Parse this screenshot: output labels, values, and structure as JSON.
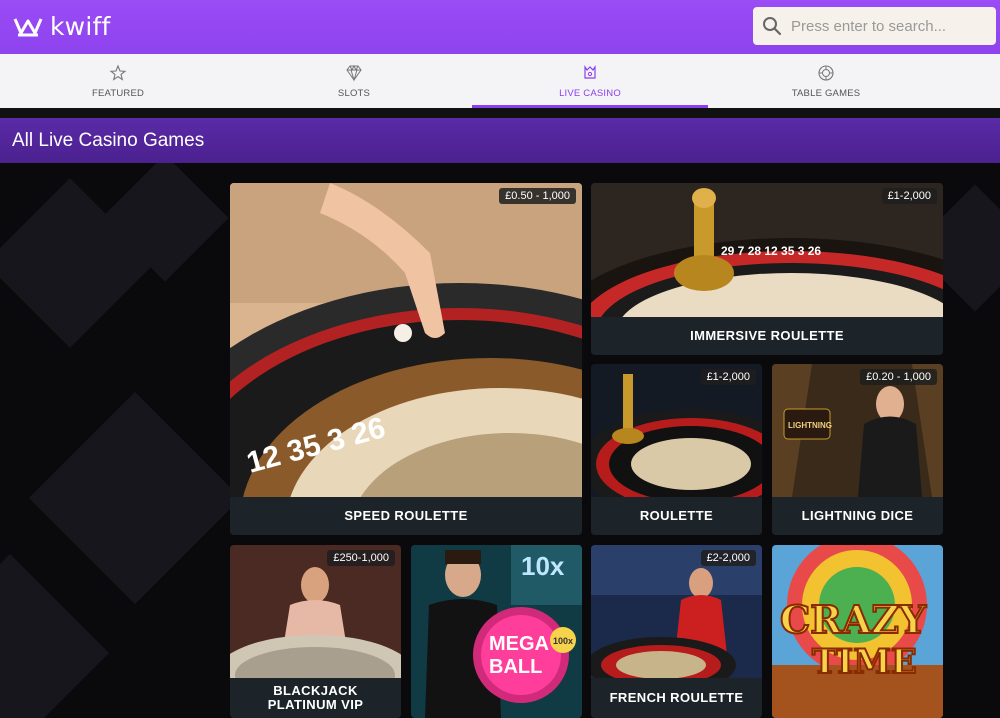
{
  "brand": {
    "name": "kwiff",
    "color": "#9147ff"
  },
  "search": {
    "placeholder": "Press enter to search..."
  },
  "tabs": [
    {
      "label": "FEATURED",
      "icon": "star-icon",
      "active": false
    },
    {
      "label": "SLOTS",
      "icon": "diamond-icon",
      "active": false
    },
    {
      "label": "LIVE CASINO",
      "icon": "live-dealer-icon",
      "active": true
    },
    {
      "label": "TABLE GAMES",
      "icon": "roulette-chip-icon",
      "active": false
    }
  ],
  "section": {
    "title": "All Live Casino Games"
  },
  "games": [
    {
      "name": "SPEED ROULETTE",
      "limit": "£0.50 - 1,000"
    },
    {
      "name": "IMMERSIVE ROULETTE",
      "limit": "£1-2,000"
    },
    {
      "name": "ROULETTE",
      "limit": "£1-2,000"
    },
    {
      "name": "LIGHTNING DICE",
      "limit": "£0.20 - 1,000"
    },
    {
      "name": "BLACKJACK PLATINUM VIP",
      "limit": "£250-1,000"
    },
    {
      "name": "MEGA BALL",
      "limit": ""
    },
    {
      "name": "FRENCH ROULETTE",
      "limit": "£2-2,000"
    },
    {
      "name": "CRAZY TIME",
      "limit": ""
    }
  ]
}
